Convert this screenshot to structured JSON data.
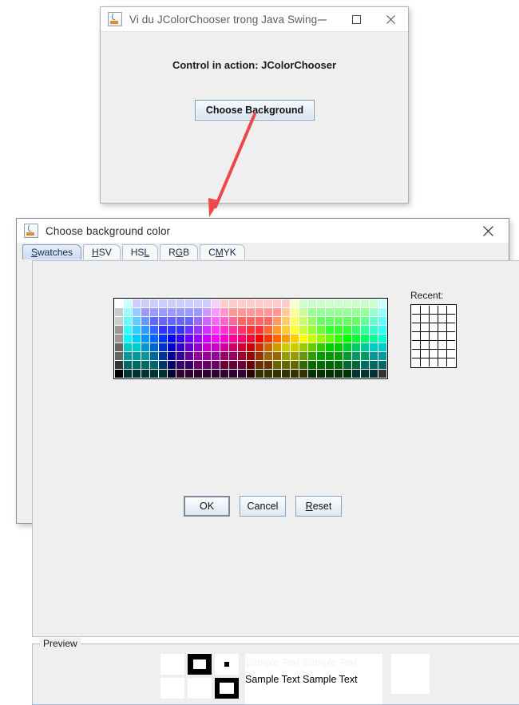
{
  "main_window": {
    "title": "Vi du JColorChooser trong Java Swing",
    "icon": "java-coffee-cup-icon",
    "minimize_label": "minimize-icon",
    "maximize_label": "maximize-icon",
    "close_label": "close-icon",
    "content_label": "Control in action: JColorChooser",
    "button_label": "Choose Background"
  },
  "annotation": {
    "type": "red-arrow",
    "color": "#f0484a",
    "from": "Choose Background button",
    "to": "Choose background color dialog"
  },
  "dialog": {
    "title": "Choose background color",
    "icon": "java-coffee-cup-icon",
    "close_label": "close-icon",
    "tabs": [
      {
        "label": "Swatches",
        "mnemonic": "S",
        "selected": true
      },
      {
        "label": "HSV",
        "mnemonic": "H",
        "selected": false
      },
      {
        "label": "HSL",
        "mnemonic": "L",
        "selected": false
      },
      {
        "label": "RGB",
        "mnemonic": "G",
        "selected": false
      },
      {
        "label": "CMYK",
        "mnemonic": "M",
        "selected": false
      }
    ],
    "swatches": {
      "columns": 31,
      "rows": 9,
      "recent_label": "Recent:",
      "recent_columns": 5,
      "recent_rows": 7,
      "recent_color": "#ffffff"
    },
    "preview": {
      "legend": "Preview",
      "sample_text_1": "Sample Text  Sample Text",
      "sample_text_2": "Sample Text  Sample Text"
    },
    "buttons": [
      {
        "label": "OK",
        "mnemonic": "",
        "focused": true
      },
      {
        "label": "Cancel",
        "mnemonic": "",
        "focused": false
      },
      {
        "label": "Reset",
        "mnemonic": "R",
        "focused": false
      }
    ]
  }
}
